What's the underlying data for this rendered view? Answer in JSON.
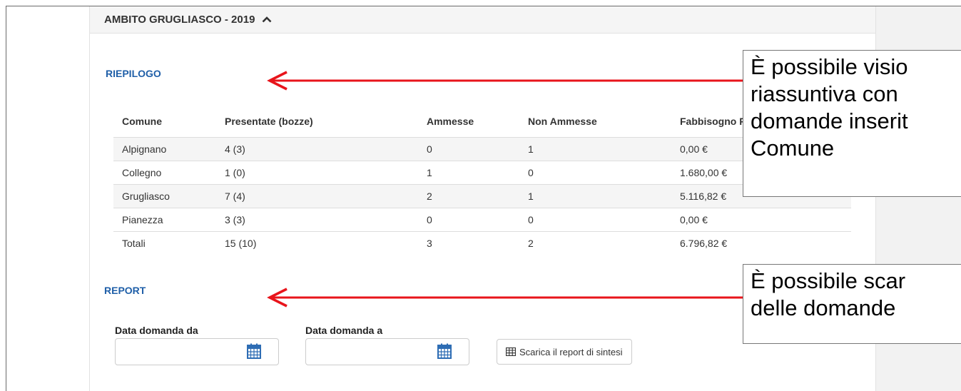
{
  "panel": {
    "title": "AMBITO GRUGLIASCO - 2019",
    "chevron_icon": "chevron-up-icon"
  },
  "summary": {
    "title": "RIEPILOGO",
    "columns": [
      "Comune",
      "Presentate (bozze)",
      "Ammesse",
      "Non Ammesse",
      "Fabbisogno Ric"
    ],
    "rows": [
      [
        "Alpignano",
        "4 (3)",
        "0",
        "1",
        "0,00 €"
      ],
      [
        "Collegno",
        "1 (0)",
        "1",
        "0",
        "1.680,00 €"
      ],
      [
        "Grugliasco",
        "7 (4)",
        "2",
        "1",
        "5.116,82 €"
      ],
      [
        "Pianezza",
        "3 (3)",
        "0",
        "0",
        "0,00 €"
      ],
      [
        "Totali",
        "15 (10)",
        "3",
        "2",
        "6.796,82 €"
      ]
    ]
  },
  "report": {
    "title": "REPORT",
    "date_from_label": "Data domanda da",
    "date_from_value": "",
    "date_to_label": "Data domanda a",
    "date_to_value": "",
    "calendar_icon": "calendar-icon",
    "download_button_label": "Scarica il report di sintesi",
    "download_button_icon": "table-icon"
  },
  "callouts": {
    "summary_note": [
      "È possibile visio",
      "riassuntiva con",
      "domande inserit",
      "Comune"
    ],
    "report_note": [
      "È possibile scar",
      "delle domande"
    ]
  },
  "colors": {
    "section_title": "#1f5fa8",
    "arrow": "#e8141b"
  }
}
